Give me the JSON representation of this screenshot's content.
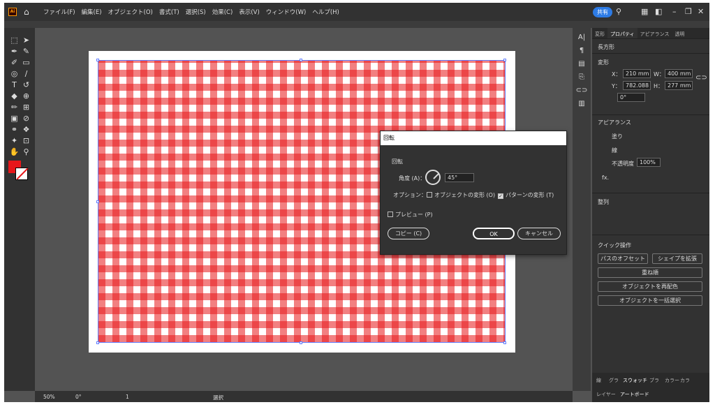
{
  "menu": [
    "ファイル(F)",
    "編集(E)",
    "オブジェクト(O)",
    "書式(T)",
    "選択(S)",
    "効果(C)",
    "表示(V)",
    "ウィンドウ(W)",
    "ヘルプ(H)"
  ],
  "share_label": "共有",
  "panel": {
    "tabs": [
      "変形",
      "プロパティ",
      "アピアランス",
      "透明"
    ],
    "object_type": "長方形",
    "transform_heading": "変形",
    "x_label": "X：",
    "x_value": "210 mm",
    "y_label": "Y：",
    "y_value": "782.088",
    "w_label": "W：",
    "w_value": "400 mm",
    "h_label": "H：",
    "h_value": "277 mm",
    "angle_value": "0°",
    "appearance_heading": "アピアランス",
    "fill_label": "塗り",
    "stroke_label": "線",
    "opacity_label": "不透明度",
    "opacity_value": "100%",
    "fx_label": "fx.",
    "align_heading": "整列",
    "quick_heading": "クイック操作",
    "offset_path": "パスのオフセット",
    "expand_shape": "シェイプを拡張",
    "arrange": "重ね順",
    "recolor": "オブジェクトを再配色",
    "select_same": "オブジェクトを一括選択"
  },
  "bottom_tabs": [
    "線",
    "グラ",
    "スウォッチ",
    "ブラ",
    "カラー",
    "カラ"
  ],
  "bottom_tabs2": [
    "レイヤー",
    "アートボード"
  ],
  "status": {
    "zoom": "50%",
    "angle": "0°",
    "page": "1",
    "mode": "選択"
  },
  "dialog": {
    "title": "回転",
    "section": "回転",
    "angle_label": "角度 (A)：",
    "angle_value": "45°",
    "options_label": "オプション：",
    "opt_objects": "オブジェクトの変形 (O)",
    "opt_patterns": "パターンの変形 (T)",
    "preview": "プレビュー (P)",
    "copy": "コピー (C)",
    "ok": "OK",
    "cancel": "キャンセル"
  },
  "colors": {
    "accent": "#2d7be5",
    "pattern_red": "#e8171a"
  }
}
